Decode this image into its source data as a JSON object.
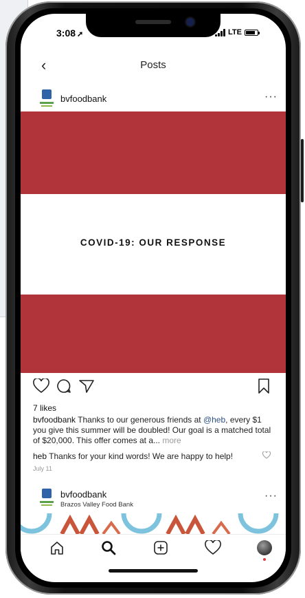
{
  "status": {
    "time": "3:08",
    "carrier": "LTE"
  },
  "nav": {
    "back": "‹",
    "title": "Posts"
  },
  "post": {
    "username": "bvfoodbank",
    "more": "···",
    "headline": "COVID-19: OUR RESPONSE",
    "likes": "7 likes",
    "caption": {
      "user": "bvfoodbank",
      "text_before": " Thanks to our generous friends at ",
      "mention": "@heb",
      "text_after": ", every $1 you give this summer will be doubled! Our goal is a matched total of $20,000. This offer comes at a...",
      "more": " more"
    },
    "comment": {
      "user": "heb",
      "text": " Thanks for your kind words! We are happy to help!"
    },
    "date": "July 11"
  },
  "post2": {
    "username": "bvfoodbank",
    "location": "Brazos Valley Food Bank",
    "more": "···"
  },
  "colors": {
    "brand_red": "#b0343a",
    "mention": "#2a4f80",
    "notification": "#e23a3a"
  }
}
